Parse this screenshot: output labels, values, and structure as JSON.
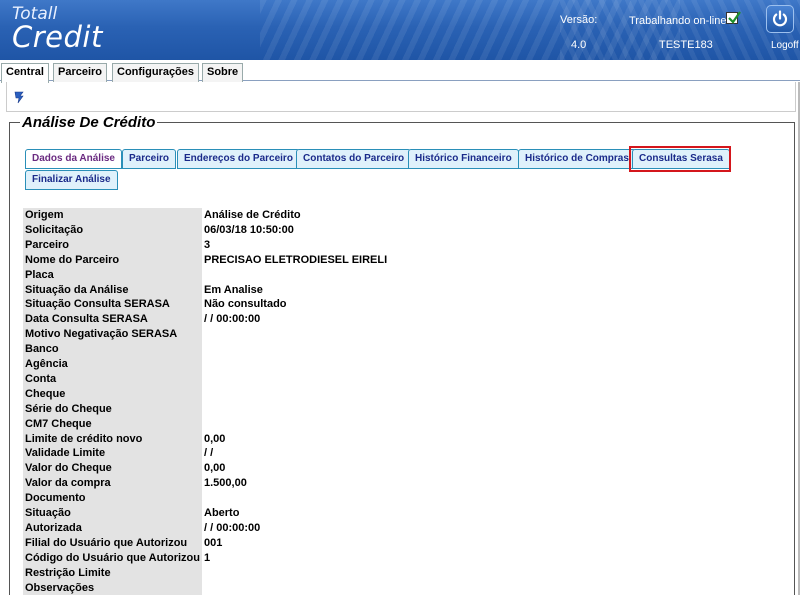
{
  "header": {
    "logo_line1": "Totall",
    "logo_line2": "Credit",
    "version_label": "Versão:",
    "version_value": "4.0",
    "online_label": "Trabalhando on-line",
    "online_checked": true,
    "user_name": "TESTE183",
    "logoff_label": "Logoff",
    "power_icon": "power-icon"
  },
  "menu": {
    "tabs": [
      {
        "label": "Central",
        "active": true
      },
      {
        "label": "Parceiro",
        "active": false
      },
      {
        "label": "Configurações",
        "active": false
      },
      {
        "label": "Sobre",
        "active": false
      }
    ]
  },
  "toolbar": {
    "filter_icon": "filter-icon"
  },
  "section": {
    "title": "Análise De Crédito"
  },
  "tabs": [
    {
      "label": "Dados da Análise",
      "active": true
    },
    {
      "label": "Parceiro",
      "active": false
    },
    {
      "label": "Endereços do Parceiro",
      "active": false
    },
    {
      "label": "Contatos do Parceiro",
      "active": false
    },
    {
      "label": "Histórico Financeiro",
      "active": false
    },
    {
      "label": "Histórico de Compras",
      "active": false
    },
    {
      "label": "Consultas Serasa",
      "active": false,
      "highlighted": true
    },
    {
      "label": "Finalizar Análise",
      "active": false
    }
  ],
  "details": [
    {
      "label": "Origem",
      "value": "Análise de Crédito"
    },
    {
      "label": "Solicitação",
      "value": "06/03/18 10:50:00"
    },
    {
      "label": "Parceiro",
      "value": "3"
    },
    {
      "label": "Nome do Parceiro",
      "value": "PRECISAO ELETRODIESEL EIRELI"
    },
    {
      "label": "Placa",
      "value": ""
    },
    {
      "label": "Situação da Análise",
      "value": "Em Analise"
    },
    {
      "label": "Situação Consulta SERASA",
      "value": "Não consultado"
    },
    {
      "label": "Data Consulta SERASA",
      "value": "/ / 00:00:00"
    },
    {
      "label": "Motivo Negativação SERASA",
      "value": ""
    },
    {
      "label": "Banco",
      "value": ""
    },
    {
      "label": "Agência",
      "value": ""
    },
    {
      "label": "Conta",
      "value": ""
    },
    {
      "label": "Cheque",
      "value": ""
    },
    {
      "label": "Série do Cheque",
      "value": ""
    },
    {
      "label": "CM7 Cheque",
      "value": ""
    },
    {
      "label": "Limite de crédito novo",
      "value": "0,00"
    },
    {
      "label": "Validade Limite",
      "value": "/ /"
    },
    {
      "label": "Valor do Cheque",
      "value": "0,00"
    },
    {
      "label": "Valor da compra",
      "value": "1.500,00"
    },
    {
      "label": "Documento",
      "value": ""
    },
    {
      "label": "Situação",
      "value": "Aberto"
    },
    {
      "label": "Autorizada",
      "value": "/ / 00:00:00"
    },
    {
      "label": "Filial do Usuário que Autorizou",
      "value": "001"
    },
    {
      "label": "Código do Usuário que Autorizou",
      "value": "1"
    },
    {
      "label": "Restrição Limite",
      "value": ""
    },
    {
      "label": "Observações",
      "value": ""
    }
  ],
  "colors": {
    "header_blue": "#2a62b4",
    "tab_border": "#2a8fb8",
    "tab_bg": "#dff1fb",
    "highlight_red": "#d4161c",
    "label_bg": "#e3e3e3"
  }
}
